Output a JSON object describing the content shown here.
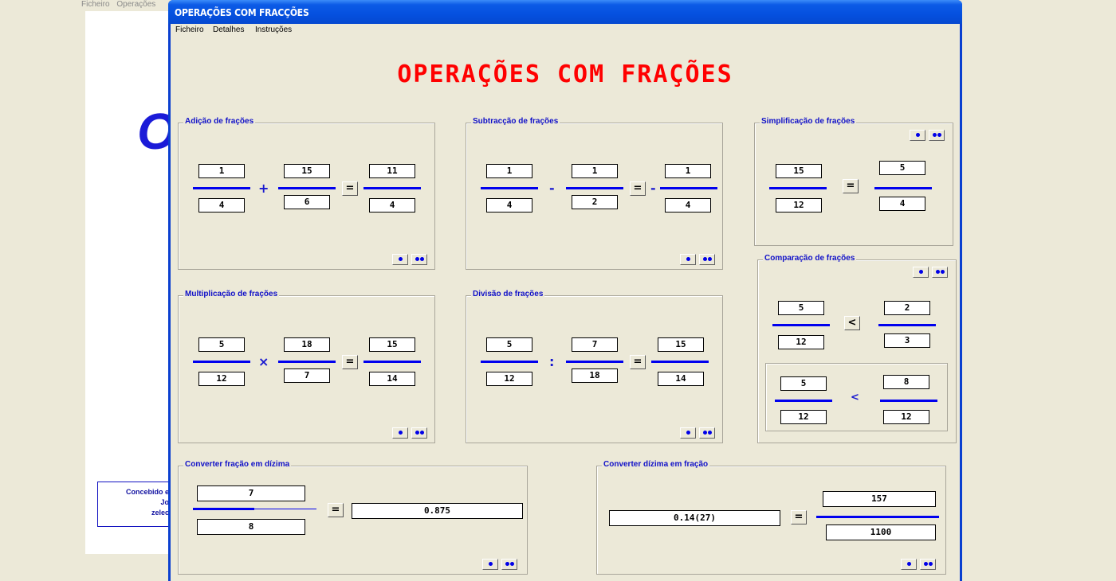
{
  "background": {
    "menu": [
      "Ficheiro",
      "Operações"
    ],
    "big_letter": "O",
    "credit_lines": [
      "Concebido e",
      "Jo",
      "zelec"
    ]
  },
  "window": {
    "title": "OPERAÇÕES COM FRACÇÕES",
    "menu": [
      "Ficheiro",
      "Detalhes",
      "Instruções"
    ],
    "heading": "OPERAÇÕES COM FRAÇÕES"
  },
  "addition": {
    "label": "Adição de frações",
    "a_num": "1",
    "a_den": "4",
    "op": "+",
    "b_num": "15",
    "b_den": "6",
    "eq": "=",
    "r_num": "11",
    "r_den": "4"
  },
  "subtraction": {
    "label": "Subtracção de frações",
    "a_num": "1",
    "a_den": "4",
    "op": "-",
    "b_num": "1",
    "b_den": "2",
    "eq": "=",
    "sign": "-",
    "r_num": "1",
    "r_den": "4"
  },
  "simplification": {
    "label": "Simplificação de frações",
    "a_num": "15",
    "a_den": "12",
    "eq": "=",
    "r_num": "5",
    "r_den": "4"
  },
  "comparison": {
    "label": "Comparação de frações",
    "a_num": "5",
    "a_den": "12",
    "cmp": "<",
    "b_num": "2",
    "b_den": "3",
    "c_num": "5",
    "c_den": "12",
    "cmp2": "<",
    "d_num": "8",
    "d_den": "12"
  },
  "multiplication": {
    "label": "Multiplicação de frações",
    "a_num": "5",
    "a_den": "12",
    "op": "×",
    "b_num": "18",
    "b_den": "7",
    "eq": "=",
    "r_num": "15",
    "r_den": "14"
  },
  "division": {
    "label": "Divisão de frações",
    "a_num": "5",
    "a_den": "12",
    "op": ":",
    "b_num": "7",
    "b_den": "18",
    "eq": "=",
    "r_num": "15",
    "r_den": "14"
  },
  "to_decimal": {
    "label": "Converter fração em dízima",
    "num": "7",
    "den": "8",
    "eq": "=",
    "result": "0.875"
  },
  "to_fraction": {
    "label": "Converter dízima em fração",
    "input": "0.14(27)",
    "eq": "=",
    "r_num": "157",
    "r_den": "1100"
  },
  "colors": {
    "title_red": "#ff0000",
    "accent_blue": "#0000ee",
    "window_blue": "#0550df",
    "face": "#ECE9D8"
  }
}
